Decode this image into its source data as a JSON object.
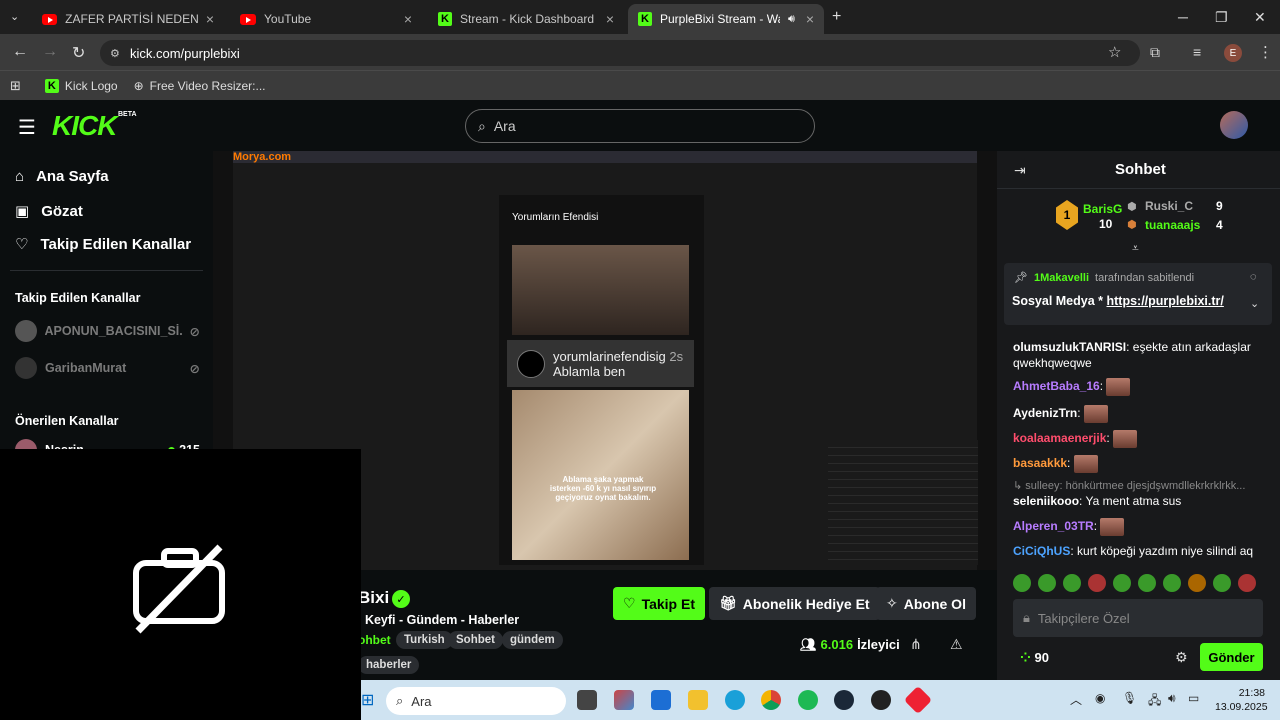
{
  "browser": {
    "tabs": [
      {
        "label": "ZAFER PARTİSİ NEDEN BAŞARIS",
        "icon": "youtube-icon"
      },
      {
        "label": "YouTube",
        "icon": "youtube-icon"
      },
      {
        "label": "Stream - Kick Dashboard",
        "icon": "kick-icon"
      },
      {
        "label": "PurpleBixi Stream - Watch L",
        "icon": "kick-icon",
        "active": true
      }
    ],
    "url": "kick.com/purplebixi",
    "bookmarks": [
      "Kick Logo",
      "Free Video Resizer:..."
    ],
    "profile_initial": "E"
  },
  "header": {
    "logo": "KICK",
    "logo_badge": "BETA",
    "search_placeholder": "Ara"
  },
  "sidebar": {
    "nav": [
      "Ana Sayfa",
      "Gözat",
      "Takip Edilen Kanallar"
    ],
    "followed_heading": "Takip Edilen Kanallar",
    "followed": [
      "APONUN_BACISINI_Sİ...",
      "GaribanMurat"
    ],
    "recommended_heading": "Önerilen Kanallar",
    "recommended": [
      {
        "name": "Nesrin",
        "viewers": "215"
      }
    ]
  },
  "video": {
    "watermark": "Morya.com",
    "channel_title": "Yorumların Efendisi",
    "comment_user": "yorumlarinefendisig",
    "comment_time": "2s",
    "comment_text": "Ablamla ben",
    "caption": "Ablama şaka yapmak isterken -60 k yı nasıl sıyırıp geçiyoruz oynat bakalım."
  },
  "stream": {
    "name": "Bixi",
    "title": "i Keyfi - Gündem - Haberler",
    "category": "ohbet",
    "tags": [
      "Turkish",
      "Sohbet",
      "gündem",
      "haberler"
    ],
    "follow_label": "Takip Et",
    "gift_label": "Abonelik Hediye Et",
    "subscribe_label": "Abone Ol",
    "viewers": "6.016",
    "viewers_label": "İzleyici"
  },
  "chat": {
    "title": "Sohbet",
    "leaderboard": [
      {
        "rank": "1",
        "user": "BarisG",
        "count": "10"
      },
      {
        "rank": "2",
        "user": "Ruski_C",
        "count": "9"
      },
      {
        "rank": "3",
        "user": "tuanaaajs",
        "count": "4"
      }
    ],
    "pinned_by": "1Makavelli",
    "pinned_suffix": "tarafından sabitlendi",
    "pinned_text": "Sosyal Medya * ",
    "pinned_link": "https://purplebixi.tr/",
    "messages": [
      {
        "user": "olumsuzlukTANRISI",
        "text": "eşekte atın arkadaşlar qwekhqweqwe",
        "color": "#ffffff"
      },
      {
        "user": "AhmetBaba_16",
        "text": "",
        "color": "#b77cff"
      },
      {
        "user": "AydenizTrn",
        "text": "",
        "color": "#ffffff"
      },
      {
        "user": "koalaamaenerjik",
        "text": "",
        "color": "#ff4d6d"
      },
      {
        "user": "basaakkk",
        "text": "",
        "color": "#ff9a3c"
      },
      {
        "user": "sulleey",
        "text": "hönkürtmee djesjdşwmdllekrkrklrkk...",
        "color": "#888888",
        "reply": true
      },
      {
        "user": "seleniikooo",
        "text": "Ya ment atma sus",
        "color": "#ffffff"
      },
      {
        "user": "Alperen_03TR",
        "text": "",
        "color": "#b77cff"
      },
      {
        "user": "CiCiQhUS",
        "text": "kurt köpeği yazdım niye silindi aq",
        "color": "#4da3ff"
      }
    ],
    "input_placeholder": "Takipçilere Özel",
    "points": "90",
    "send_label": "Gönder"
  },
  "taskbar": {
    "search_placeholder": "Ara",
    "time": "21:38",
    "date": "13.09.2025"
  }
}
